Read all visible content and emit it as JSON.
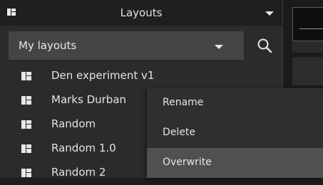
{
  "header": {
    "title": "Layouts",
    "icon": "layout-icon",
    "chevron": "chevron-down-icon"
  },
  "selector": {
    "value": "My layouts",
    "chevron": "chevron-down-icon"
  },
  "search": {
    "icon": "search-icon"
  },
  "layouts": [
    {
      "label": "Den experiment v1",
      "icon": "layout-icon"
    },
    {
      "label": "Marks Durban",
      "icon": "layout-icon"
    },
    {
      "label": "Random",
      "icon": "layout-icon"
    },
    {
      "label": "Random 1.0",
      "icon": "layout-icon"
    },
    {
      "label": "Random 2",
      "icon": "layout-icon"
    }
  ],
  "context_menu": {
    "items": [
      {
        "label": "Rename"
      },
      {
        "label": "Delete"
      },
      {
        "label": "Overwrite",
        "highlighted": true
      }
    ]
  },
  "colors": {
    "panel_bg": "#2b2b2b",
    "header_bg": "#1f1f1f",
    "selector_bg": "#454545",
    "menu_bg": "#2f2f2f",
    "menu_highlight": "#505050",
    "text": "#e6e6e6"
  }
}
